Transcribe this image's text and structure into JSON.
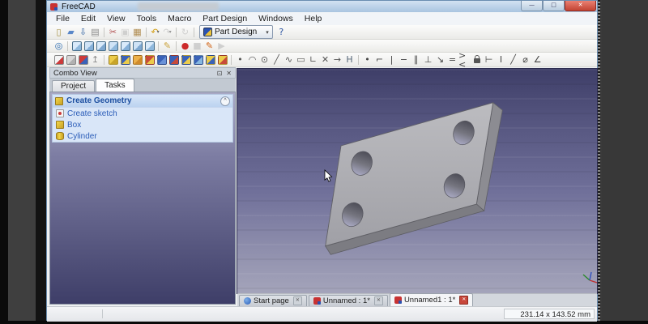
{
  "window": {
    "title": "FreeCAD",
    "min_glyph": "—",
    "max_glyph": "□",
    "close_glyph": "✕"
  },
  "menu": {
    "items": [
      "File",
      "Edit",
      "View",
      "Tools",
      "Macro",
      "Part Design",
      "Windows",
      "Help"
    ]
  },
  "toolbar_row1": [
    {
      "name": "new-document-icon",
      "glyph": "▯",
      "color": "#a08a3a"
    },
    {
      "name": "open-file-icon",
      "glyph": "▰",
      "color": "#5a87c8"
    },
    {
      "name": "save-icon",
      "glyph": "⇩",
      "color": "#3465a4"
    },
    {
      "name": "print-icon",
      "glyph": "▤",
      "color": "#8a8a8a"
    },
    {
      "type": "sep"
    },
    {
      "name": "cut-icon",
      "glyph": "✂",
      "color": "#b05050"
    },
    {
      "name": "copy-icon",
      "glyph": "▣",
      "disabled": true
    },
    {
      "name": "paste-icon",
      "glyph": "▦",
      "color": "#b08c50"
    },
    {
      "type": "sep"
    },
    {
      "name": "undo-icon",
      "glyph": "↶",
      "color": "#d4a017",
      "dd": true
    },
    {
      "name": "redo-icon",
      "glyph": "↷",
      "disabled": true,
      "dd": true
    },
    {
      "type": "sep"
    },
    {
      "name": "refresh-icon",
      "glyph": "↻",
      "disabled": true
    },
    {
      "type": "sep"
    },
    {
      "type": "combo",
      "name": "workbench-selector",
      "label": "Part Design"
    },
    {
      "name": "whats-this-icon",
      "glyph": "?",
      "color": "#2a52a0"
    }
  ],
  "toolbar_row2": [
    {
      "name": "fit-all-icon",
      "glyph": "◎",
      "color": "#2a6ab0"
    },
    {
      "type": "sep"
    },
    {
      "name": "axonometric-view-icon",
      "cls": "ic-cube",
      "c1": "#d9eafa",
      "c2": "#8fb8dc"
    },
    {
      "name": "front-view-icon",
      "cls": "ic-cube",
      "c1": "#cfe3f6",
      "c2": "#86b0d8"
    },
    {
      "name": "top-view-icon",
      "cls": "ic-cube",
      "c1": "#d9eafa",
      "c2": "#7fa8d0"
    },
    {
      "name": "right-view-icon",
      "cls": "ic-cube",
      "c1": "#cfe3f6",
      "c2": "#8fb8dc"
    },
    {
      "name": "rear-view-icon",
      "cls": "ic-cube",
      "c1": "#d9eafa",
      "c2": "#86b0d8"
    },
    {
      "name": "bottom-view-icon",
      "cls": "ic-cube",
      "c1": "#cfe3f6",
      "c2": "#7fa8d0"
    },
    {
      "name": "left-view-icon",
      "cls": "ic-cube",
      "c1": "#d9eafa",
      "c2": "#8fb8dc"
    },
    {
      "type": "sep"
    },
    {
      "name": "measure-distance-icon",
      "glyph": "✎",
      "color": "#caa23a"
    },
    {
      "type": "sep"
    },
    {
      "name": "macro-record-icon",
      "glyph": "●",
      "color": "#cc2a2a"
    },
    {
      "name": "macro-stop-icon",
      "glyph": "■",
      "disabled": true
    },
    {
      "name": "macro-edit-icon",
      "glyph": "✎",
      "color": "#d06010"
    },
    {
      "name": "macro-debug-icon",
      "glyph": "▶",
      "disabled": true
    }
  ],
  "toolbar_row3": [
    {
      "name": "create-sketch-icon",
      "cls": "ic-sk",
      "c1": "#f4f4f4",
      "c2": "#cc3a3a"
    },
    {
      "name": "view-sketch-icon",
      "cls": "ic-sk",
      "c1": "#d8d8d8",
      "c2": "#b0b0b0"
    },
    {
      "name": "map-sketch-icon",
      "cls": "ic-sk",
      "c1": "#cc3a3a",
      "c2": "#3a62b8"
    },
    {
      "name": "leave-sketch-icon",
      "glyph": "↥",
      "color": "#8a8a8a"
    },
    {
      "type": "sep"
    },
    {
      "name": "pad-icon",
      "cls": "ic-pd",
      "c1": "#eccc4a",
      "c2": "#c8a428"
    },
    {
      "name": "pocket-icon",
      "cls": "ic-pd",
      "c1": "#3a62b8",
      "c2": "#eccc4a"
    },
    {
      "name": "revolution-icon",
      "cls": "ic-pd",
      "c1": "#ecb04a",
      "c2": "#d08a2a"
    },
    {
      "name": "groove-icon",
      "cls": "ic-pd",
      "c1": "#c84a3a",
      "c2": "#eccc4a"
    },
    {
      "name": "fillet-icon",
      "cls": "ic-pd",
      "c1": "#3a62b8",
      "c2": "#6a92d8"
    },
    {
      "name": "chamfer-icon",
      "cls": "ic-pd",
      "c1": "#3a62b8",
      "c2": "#c84a3a"
    },
    {
      "name": "draft-icon",
      "cls": "ic-pd",
      "c1": "#3a62b8",
      "c2": "#eccc4a"
    },
    {
      "name": "mirrored-icon",
      "cls": "ic-pd",
      "c1": "#3a62b8",
      "c2": "#86b7e0"
    },
    {
      "name": "linear-pattern-icon",
      "cls": "ic-pd",
      "c1": "#eccc4a",
      "c2": "#3a62b8"
    },
    {
      "name": "polar-pattern-icon",
      "cls": "ic-pd",
      "c1": "#eccc4a",
      "c2": "#c84a3a"
    },
    {
      "type": "sep"
    },
    {
      "name": "sketch-point-icon",
      "glyph": "•",
      "color": "#555555"
    },
    {
      "name": "sketch-arc-icon",
      "glyph": "◠",
      "color": "#555555"
    },
    {
      "name": "sketch-circle-icon",
      "glyph": "⊙",
      "color": "#555555"
    },
    {
      "name": "sketch-line-icon",
      "glyph": "╱",
      "color": "#555555"
    },
    {
      "name": "sketch-polyline-icon",
      "glyph": "∿",
      "color": "#555555"
    },
    {
      "name": "sketch-rectangle-icon",
      "glyph": "▭",
      "color": "#555555"
    },
    {
      "name": "sketch-fillet-icon",
      "glyph": "∟",
      "color": "#555555"
    },
    {
      "name": "sketch-trim-icon",
      "glyph": "✕",
      "color": "#555555"
    },
    {
      "name": "sketch-extend-icon",
      "glyph": "→",
      "color": "#555555"
    },
    {
      "name": "sketch-external-geometry-icon",
      "glyph": "H",
      "color": "#556677"
    },
    {
      "type": "sep"
    },
    {
      "name": "constraint-coincident-icon",
      "glyph": "•",
      "color": "#444444"
    },
    {
      "name": "constraint-point-on-object-icon",
      "glyph": "⌐",
      "color": "#444444"
    },
    {
      "name": "constraint-vertical-icon",
      "glyph": "|",
      "color": "#444444"
    },
    {
      "name": "constraint-horizontal-icon",
      "glyph": "−",
      "color": "#444444"
    },
    {
      "name": "constraint-parallel-icon",
      "glyph": "∥",
      "color": "#444444"
    },
    {
      "name": "constraint-perpendicular-icon",
      "glyph": "⊥",
      "color": "#444444"
    },
    {
      "name": "constraint-tangent-icon",
      "glyph": "↘",
      "color": "#444444"
    },
    {
      "name": "constraint-equal-icon",
      "glyph": "=",
      "color": "#444444"
    },
    {
      "name": "constraint-symmetric-icon",
      "glyph": "><",
      "color": "#444444"
    },
    {
      "name": "constraint-lock-icon",
      "cls": "ic-lock"
    },
    {
      "name": "constraint-horizontal-distance-icon",
      "glyph": "⊢",
      "color": "#444444"
    },
    {
      "name": "constraint-vertical-distance-icon",
      "glyph": "I",
      "color": "#444444"
    },
    {
      "name": "constraint-length-icon",
      "glyph": "╱",
      "color": "#444444"
    },
    {
      "name": "constraint-radius-icon",
      "glyph": "⌀",
      "color": "#444444"
    },
    {
      "name": "constraint-angle-icon",
      "glyph": "∠",
      "color": "#444444"
    }
  ],
  "combo_view": {
    "title": "Combo View",
    "float_glyph": "⊡",
    "close_glyph": "✕",
    "tabs": [
      {
        "label": "Project",
        "active": false
      },
      {
        "label": "Tasks",
        "active": true
      }
    ],
    "task_section": {
      "title": "Create Geometry",
      "collapse_glyph": "^",
      "items": [
        {
          "label": "Create sketch",
          "icon_cls": "ic-sk-sm",
          "icon_name": "sketch-icon"
        },
        {
          "label": "Box",
          "icon_cls": "ic-box-sm",
          "icon_name": "box-icon"
        },
        {
          "label": "Cylinder",
          "icon_cls": "ic-cyl-sm",
          "icon_name": "cylinder-icon"
        }
      ]
    }
  },
  "mdi_tabs": [
    {
      "label": "Start page",
      "icon": "globe",
      "active": false
    },
    {
      "label": "Unnamed : 1*",
      "icon": "fc",
      "active": false
    },
    {
      "label": "Unnamed1 : 1*",
      "icon": "fc",
      "active": true
    }
  ],
  "status": {
    "size_readout": "231.14 x 143.52 mm"
  },
  "colors": {
    "titlebar": "#b9d0e8",
    "viewport_top": "#3e3e68",
    "viewport_bottom": "#a4a4ba",
    "task_text": "#2a5cb8",
    "plate_gray": "#aeaeb2",
    "close_button_red": "#c8463a"
  }
}
